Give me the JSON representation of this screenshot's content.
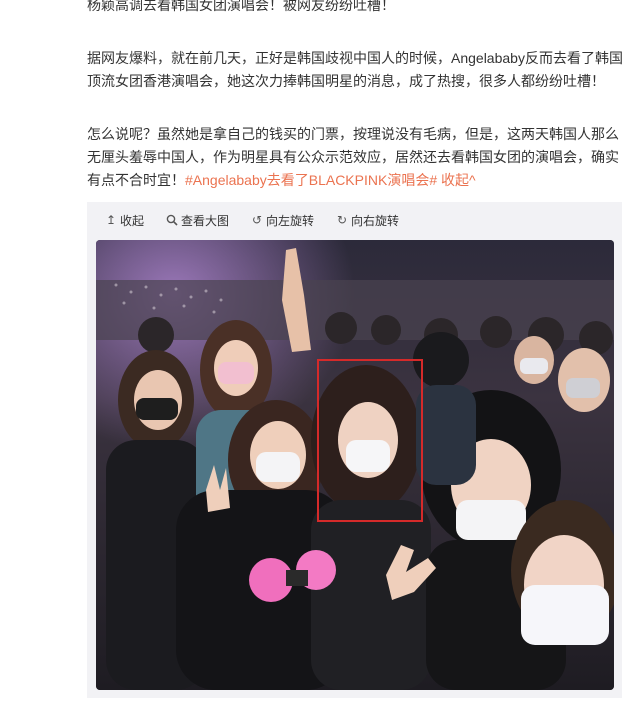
{
  "post": {
    "paragraphs": [
      "杨颖高调去看韩国女团演唱会！被网友纷纷吐槽！",
      "据网友爆料，就在前几天，正好是韩国歧视中国人的时候，Angelababy反而去看了韩国顶流女团香港演唱会，她这次力捧韩国明星的消息，成了热搜，很多人都纷纷吐槽！",
      "怎么说呢？虽然她是拿自己的钱买的门票，按理说没有毛病，但是，这两天韩国人那么无厘头羞辱中国人，作为明星具有公众示范效应，居然还去看韩国女团的演唱会，确实有点不合时宜！"
    ],
    "topic_link": "#Angelababy去看了BLACKPINK演唱会#",
    "collapse_link": "收起^"
  },
  "toolbar": {
    "collapse": {
      "label": "收起",
      "icon": "collapse-up-icon"
    },
    "view_large": {
      "label": "查看大图",
      "icon": "magnifier-icon"
    },
    "rotate_left": {
      "label": "向左旋转",
      "icon": "rotate-left-icon"
    },
    "rotate_right": {
      "label": "向右旋转",
      "icon": "rotate-right-icon"
    }
  },
  "colors": {
    "link": "#eb7350",
    "highlight": "#d52a2a",
    "panel": "#f2f2f5"
  }
}
